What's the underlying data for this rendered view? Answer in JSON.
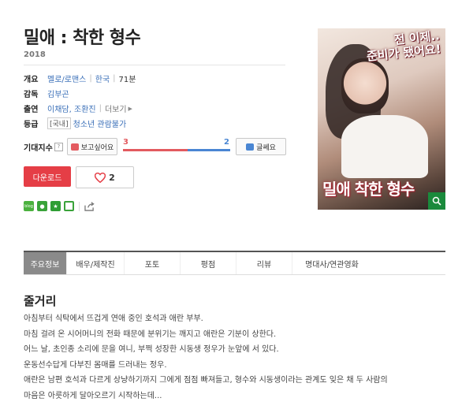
{
  "movie": {
    "title": "밀애 : 착한 형수",
    "year": "2018",
    "overview_label": "개요",
    "genre": "멜로/로맨스",
    "country": "한국",
    "runtime": "71분",
    "director_label": "감독",
    "director": "김부곤",
    "cast_label": "출연",
    "cast": "이채담, 조환진",
    "cast_more": "더보기",
    "rating_label": "등급",
    "rating_region": "[국내]",
    "rating": "청소년 관람불가"
  },
  "anticipation": {
    "label": "기대지수",
    "help": "?",
    "want_label": "보고싶어요",
    "want_count": "3",
    "dont_label": "글쎄요",
    "dont_count": "2",
    "want_ratio": 0.6
  },
  "actions": {
    "download_label": "다운로드",
    "like_count": "2"
  },
  "poster": {
    "tagline": "전 이제... 준비가 됐어요!",
    "tagline_line1": "전 이제..",
    "tagline_line2": "준비가 됐어요!",
    "title_text": "밀애 착한 형수"
  },
  "tabs": [
    {
      "label": "주요정보"
    },
    {
      "label": "배우/제작진"
    },
    {
      "label": "포토"
    },
    {
      "label": "평점"
    },
    {
      "label": "리뷰"
    },
    {
      "label": "명대사/연관영화"
    }
  ],
  "synopsis": {
    "heading": "줄거리",
    "lines": [
      "아침부터 식탁에서 뜨겁게 연애 중인 호석과 애란 부부.",
      " 마침 걸려 온 시어머니의 전화 때문에 분위기는 깨지고 애란은 기분이 상한다.",
      " 어느 날, 초인종 소리에 문을 여니, 부쩍 성장한 시동생 정우가 눈앞에 서 있다.",
      " 운동선수답게 다부진 몸매를 드러내는 정우.",
      " 애란은 남편 호석과 다르게 상냥하기까지 그에게 점점 빠져들고, 형수와 시동생이라는 관계도 잊은 채 두 사람의",
      "마음은 아릇하게 달아오르기 시작하는데..."
    ]
  },
  "colors": {
    "accent_red": "#e53e46",
    "link_blue": "#3a6fb8",
    "tab_active": "#8a8a8a"
  }
}
